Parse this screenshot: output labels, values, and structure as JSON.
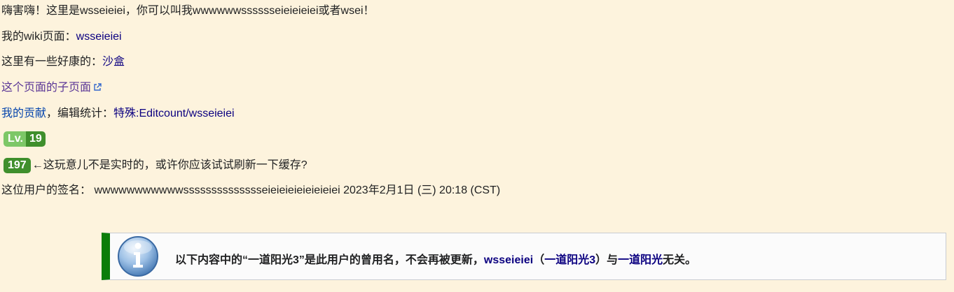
{
  "intro": {
    "text": "嗨害嗨！这里是wsseieiei，你可以叫我wwwwwwsssssseieieieiei或者wsei！"
  },
  "wiki_page": {
    "label": "我的wiki页面：",
    "link": "wsseieiei"
  },
  "sandbox": {
    "label": "这里有一些好康的：",
    "link": "沙盒"
  },
  "subpages": {
    "link": "这个页面的子页面",
    "icon": "external-link-icon"
  },
  "contrib": {
    "link": "我的贡献",
    "separator": "，编辑统计：",
    "stats_link": "特殊:Editcount/wsseieiei"
  },
  "level": {
    "prefix": "Lv.",
    "value": "19"
  },
  "edits": {
    "count": "197",
    "note": "←这玩意儿不是实时的，或许你应该试试刷新一下缓存?"
  },
  "signature": {
    "label": "这位用户的签名：",
    "user": "wwwwwwwwwwwsssssssssssssseieieieieieieieiei",
    "timestamp": "2023年2月1日 (三) 20:18 (CST)"
  },
  "notice": {
    "icon": "info-icon",
    "text_before": "以下内容中的“一道阳光3”是此用户的曾用名，不会再被更新，",
    "link_user": "wsseieiei",
    "text_paren_open": "（",
    "link_old": "一道阳光3",
    "text_paren_close": "）",
    "text_with": "与",
    "link_other": "一道阳光",
    "text_end": "无关。"
  },
  "colors": {
    "background": "#fdf3dd",
    "link": "#0b0080",
    "level_light": "#7dc767",
    "level_dark": "#3f8f2c",
    "notice_border": "#0a7d0a"
  }
}
